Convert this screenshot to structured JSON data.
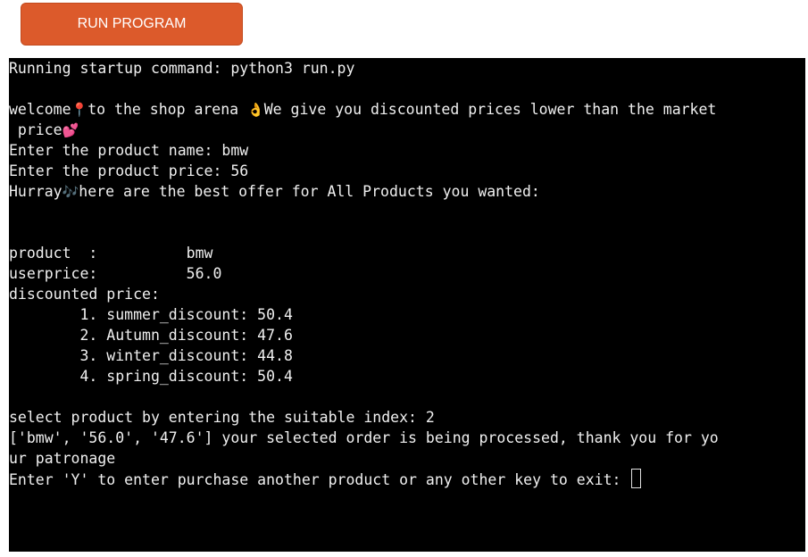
{
  "toolbar": {
    "run_label": "RUN PROGRAM",
    "run_color": "#dc5a2b"
  },
  "terminal": {
    "background": "#000000",
    "lines": {
      "startup": "Running startup command: python3 run.py",
      "welcome_a": "welcome",
      "welcome_pin": "📍",
      "welcome_b": "to the shop arena ",
      "welcome_ok": "👌",
      "welcome_c": "We give you discounted prices lower than the market",
      "price_a": " price",
      "price_heart": "💕",
      "enter_name": "Enter the product name: bmw",
      "enter_price": "Enter the product price: 56",
      "hurray_a": "Hurray",
      "hurray_notes": "🎶",
      "hurray_b": "here are the best offer for All Products you wanted:",
      "product": "product  :          bmw",
      "userprice": "userprice:          56.0",
      "discounted": "discounted price:",
      "d1": "        1. summer_discount: 50.4",
      "d2": "        2. Autumn_discount: 47.6",
      "d3": "        3. winter_discount: 44.8",
      "d4": "        4. spring_discount: 50.4",
      "select": "select product by entering the suitable index: 2",
      "order_a": "['bmw', '56.0', '47.6'] your selected order is being processed, thank you for yo",
      "order_b": "ur patronage",
      "again": "Enter 'Y' to enter purchase another product or any other key to exit: "
    }
  }
}
